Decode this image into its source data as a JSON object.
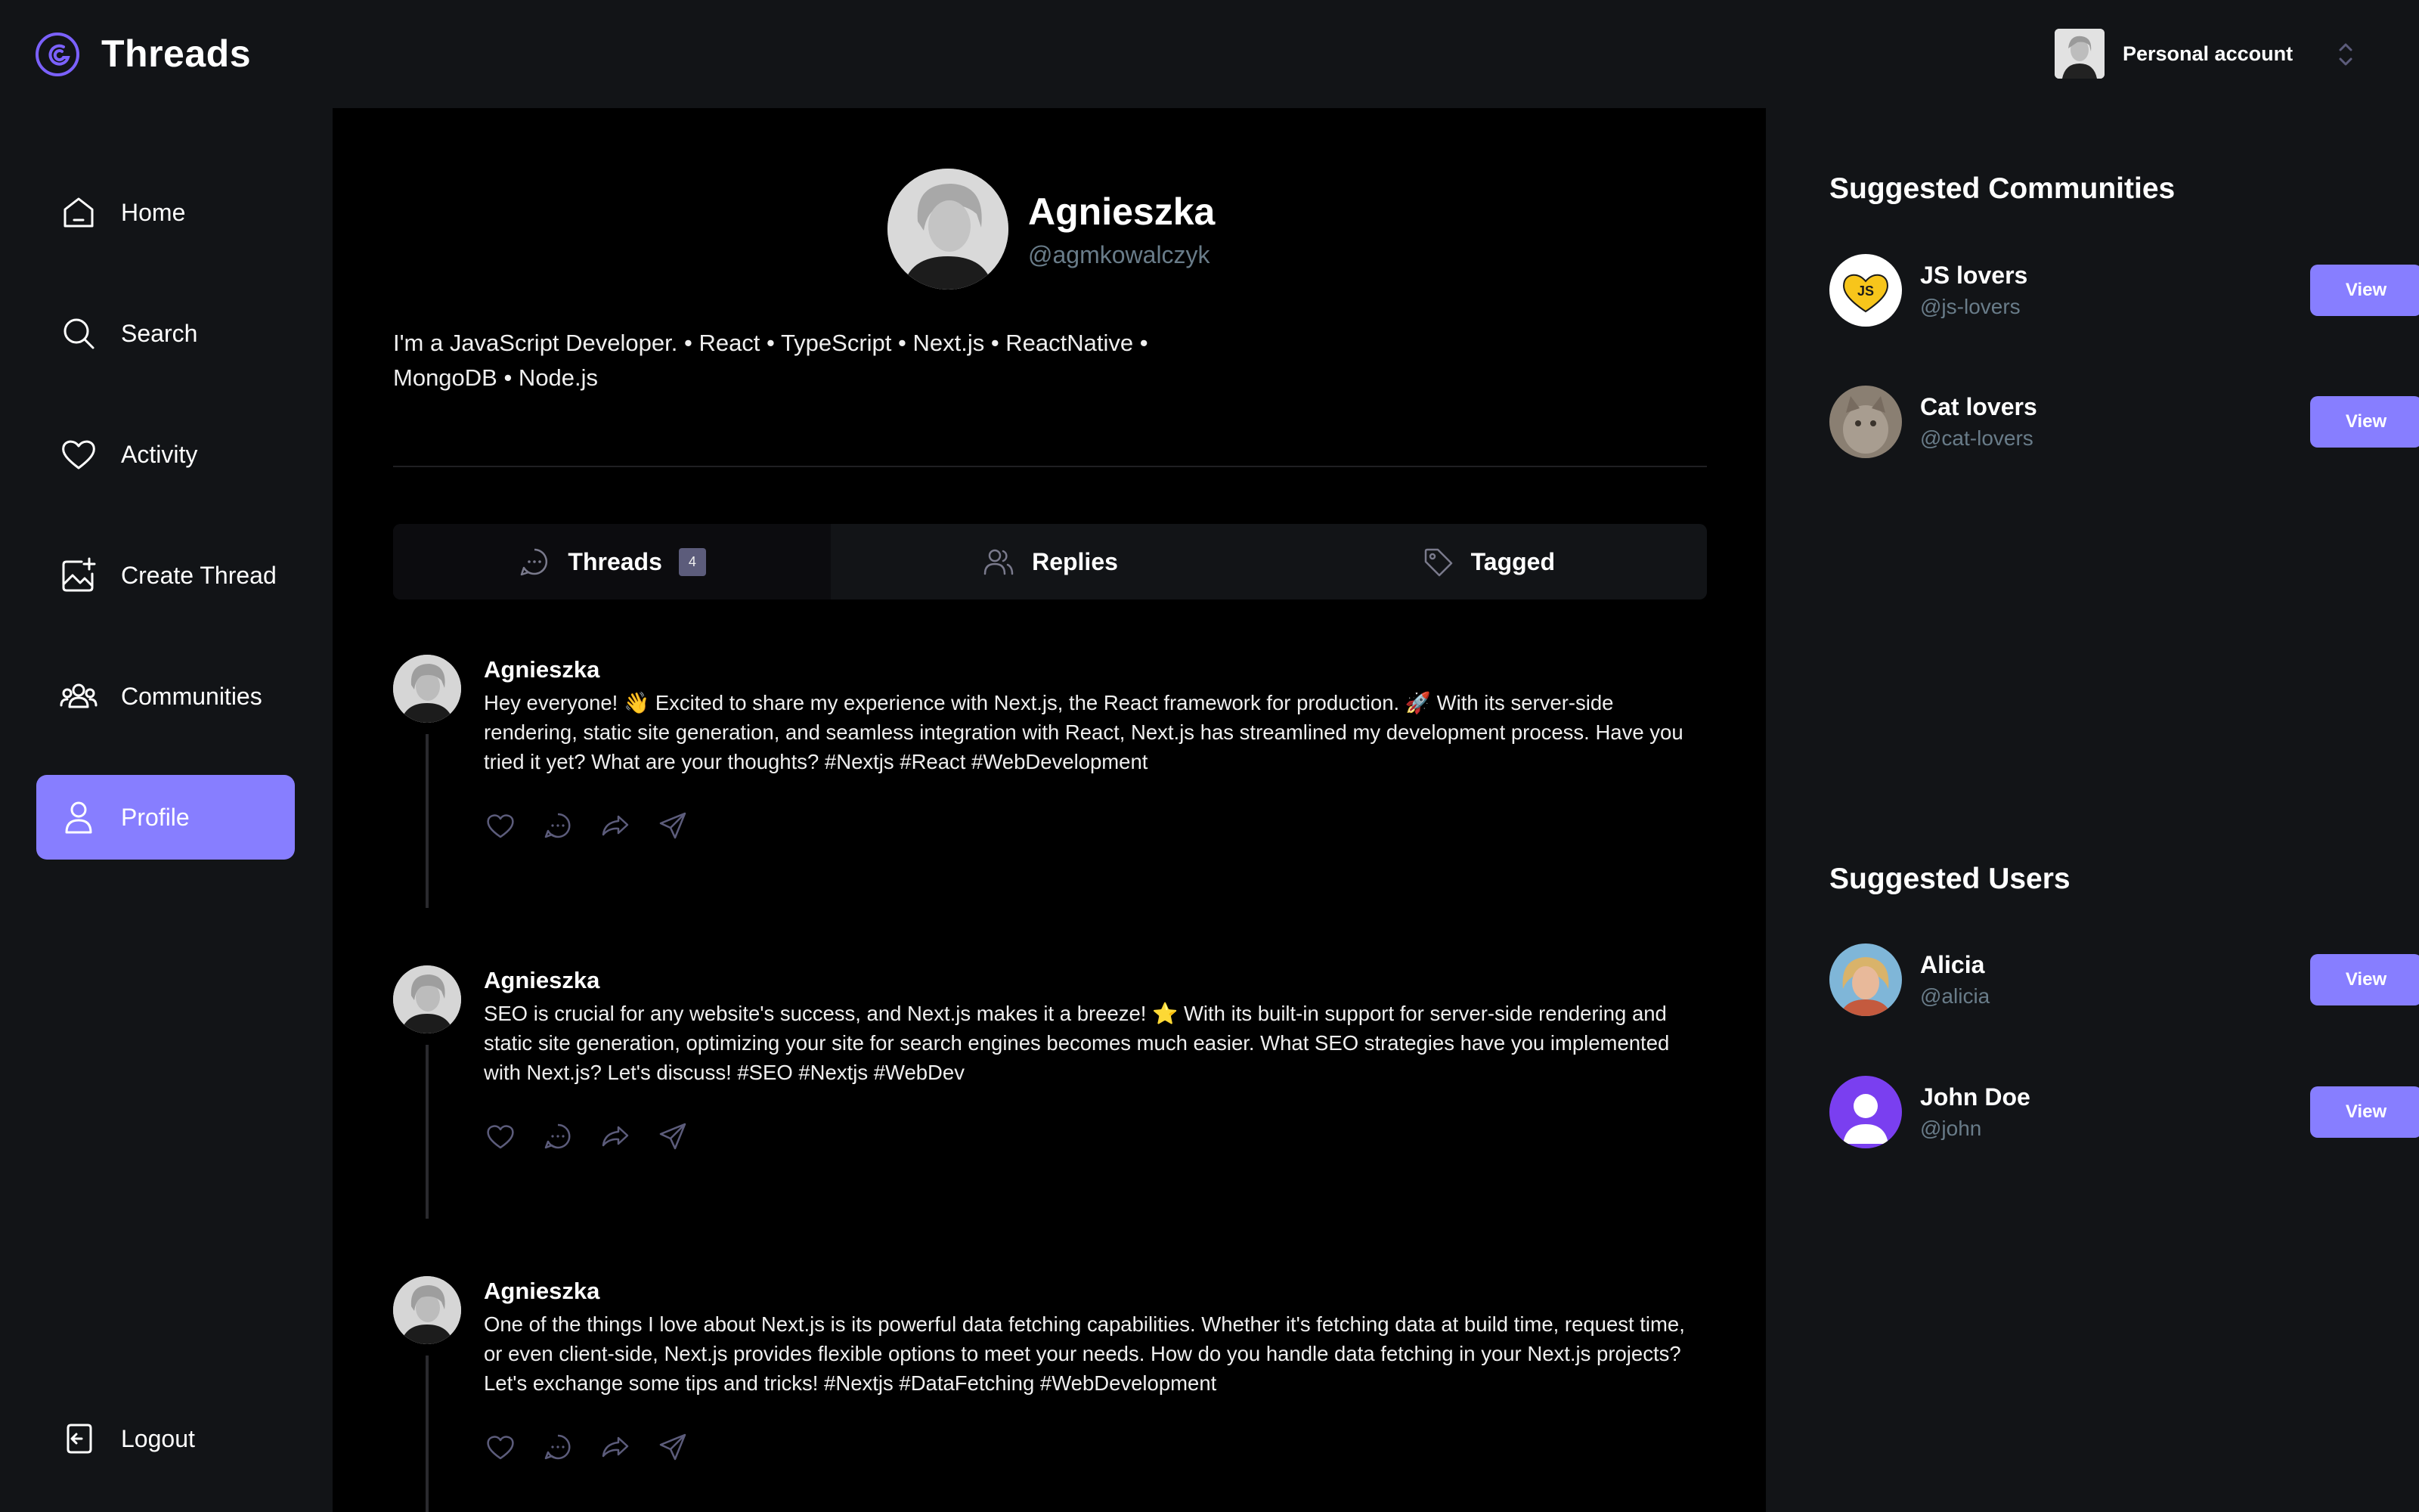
{
  "app": {
    "title": "Threads"
  },
  "account": {
    "label": "Personal account"
  },
  "nav": {
    "items": [
      {
        "label": "Home",
        "icon": "home-icon"
      },
      {
        "label": "Search",
        "icon": "search-icon"
      },
      {
        "label": "Activity",
        "icon": "heart-icon"
      },
      {
        "label": "Create Thread",
        "icon": "create-image-icon"
      },
      {
        "label": "Communities",
        "icon": "users-icon"
      },
      {
        "label": "Profile",
        "icon": "user-icon"
      }
    ],
    "active": "Profile",
    "logout": {
      "label": "Logout",
      "icon": "logout-icon"
    }
  },
  "profile": {
    "name": "Agnieszka",
    "handle": "@agmkowalczyk",
    "bio": "I'm a JavaScript Developer. • React • TypeScript • Next.js • ReactNative • MongoDB • Node.js"
  },
  "tabs": [
    {
      "label": "Threads",
      "badge": "4",
      "icon": "chat-icon"
    },
    {
      "label": "Replies",
      "icon": "members-icon"
    },
    {
      "label": "Tagged",
      "icon": "tag-icon"
    }
  ],
  "posts": [
    {
      "author": "Agnieszka",
      "text": "Hey everyone! 👋 Excited to share my experience with Next.js, the React framework for production. 🚀 With its server-side rendering, static site generation, and seamless integration with React, Next.js has streamlined my development process. Have you tried it yet? What are your thoughts? #Nextjs #React #WebDevelopment"
    },
    {
      "author": "Agnieszka",
      "text": "SEO is crucial for any website's success, and Next.js makes it a breeze! ⭐ With its built-in support for server-side rendering and static site generation, optimizing your site for search engines becomes much easier. What SEO strategies have you implemented with Next.js? Let's discuss! #SEO #Nextjs #WebDev"
    },
    {
      "author": "Agnieszka",
      "text": "One of the things I love about Next.js is its powerful data fetching capabilities. Whether it's fetching data at build time, request time, or even client-side, Next.js provides flexible options to meet your needs. How do you handle data fetching in your Next.js projects? Let's exchange some tips and tricks! #Nextjs #DataFetching #WebDevelopment"
    }
  ],
  "suggested_communities": {
    "title": "Suggested Communities",
    "items": [
      {
        "name": "JS lovers",
        "handle": "@js-lovers",
        "button": "View",
        "avatar_text": "JS"
      },
      {
        "name": "Cat lovers",
        "handle": "@cat-lovers",
        "button": "View"
      }
    ]
  },
  "suggested_users": {
    "title": "Suggested Users",
    "items": [
      {
        "name": "Alicia",
        "handle": "@alicia",
        "button": "View"
      },
      {
        "name": "John Doe",
        "handle": "@john",
        "button": "View"
      }
    ]
  },
  "colors": {
    "accent": "#877eff",
    "bg_dark": "#121417",
    "bg_main": "#000000",
    "muted_text": "#697c89"
  }
}
